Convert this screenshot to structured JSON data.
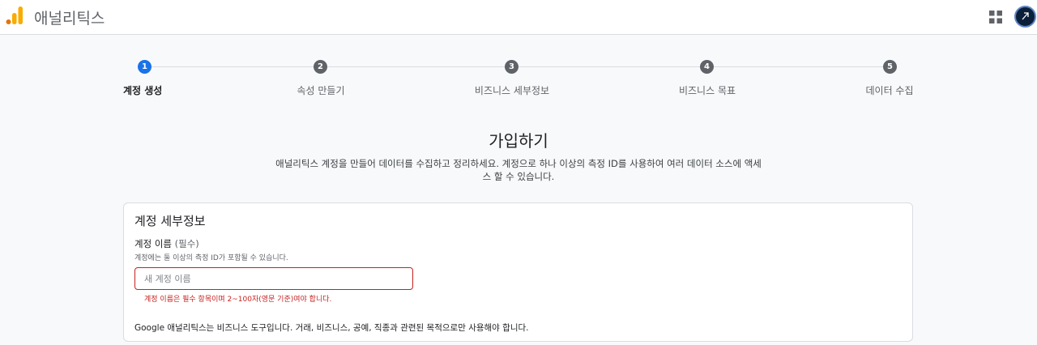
{
  "header": {
    "app_title": "애널리틱스",
    "logo_icon": "analytics-logo-icon",
    "apps_icon": "apps-grid-icon",
    "avatar_icon": "account-avatar-icon"
  },
  "stepper": {
    "steps": [
      {
        "number": "1",
        "label": "계정 생성",
        "state": "active"
      },
      {
        "number": "2",
        "label": "속성 만들기",
        "state": "pending"
      },
      {
        "number": "3",
        "label": "비즈니스 세부정보",
        "state": "pending"
      },
      {
        "number": "4",
        "label": "비즈니스 목표",
        "state": "pending"
      },
      {
        "number": "5",
        "label": "데이터 수집",
        "state": "pending"
      }
    ]
  },
  "signup": {
    "title": "가입하기",
    "description": "애널리틱스 계정을 만들어 데이터를 수집하고 정리하세요. 계정으로 하나 이상의 측정 ID를 사용하여 여러 데이터 소스에 액세스 할 수 있습니다."
  },
  "account_details": {
    "title": "계정 세부정보",
    "name_label": "계정 이름",
    "name_required": "(필수)",
    "name_hint": "계정에는 둘 이상의 측정 ID가 포함될 수 있습니다.",
    "name_value": "",
    "name_placeholder": "새 계정 이름",
    "name_error": "계정 이름은 필수 항목이며 2~100자(영문 기준)여야 합니다.",
    "notice": "Google 애널리틱스는 비즈니스 도구입니다. 거래, 비즈니스, 공예, 직종과 관련된 목적으로만 사용해야 합니다."
  },
  "colors": {
    "accent": "#1a73e8",
    "error": "#c5221f",
    "logo_primary": "#f9ab00",
    "logo_secondary": "#e37400"
  }
}
